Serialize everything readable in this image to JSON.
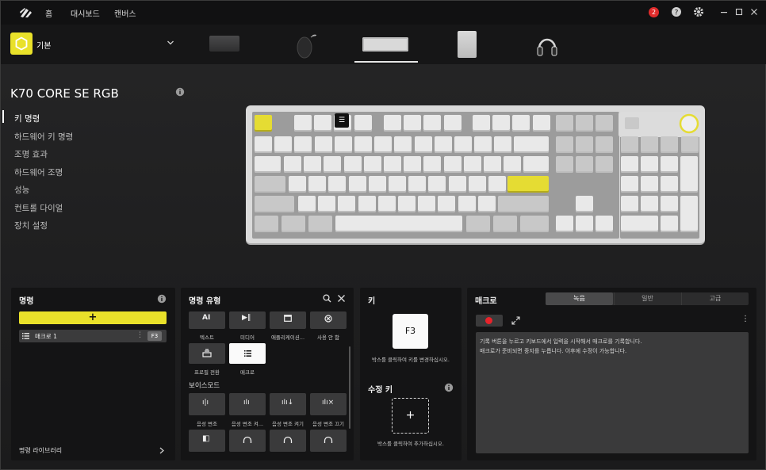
{
  "titlebar": {
    "nav": [
      "홈",
      "대시보드",
      "캔버스"
    ],
    "notif_count": "2"
  },
  "profile": {
    "name": "기본"
  },
  "device": {
    "name": "K70 CORE SE RGB"
  },
  "left_menu": [
    "키 명령",
    "하드웨어 키 명령",
    "조명 효과",
    "하드웨어 조명",
    "성능",
    "컨트롤 다이얼",
    "장치 설정"
  ],
  "commands_panel": {
    "title": "명령",
    "add": "+",
    "item_label": "매크로 1",
    "item_key": "F3",
    "library": "명령 라이브러리"
  },
  "command_types": {
    "title": "명령 유형",
    "row1": [
      "텍스트",
      "미디어",
      "애플리케이션...",
      "사용 안 함"
    ],
    "row2": [
      "프로필 전환",
      "매크로"
    ],
    "section": "보이스모드",
    "row3": [
      "음성 변조",
      "음성 변조 켜...",
      "음성 변조 켜기",
      "음성 변조 끄기"
    ]
  },
  "key_panel": {
    "title": "키",
    "key": "F3",
    "hint": "박스를 클릭하여 키를 변경하십시오.",
    "modifier_title": "수정 키",
    "modifier_add": "+",
    "modifier_hint": "박스를 클릭하여 추가하십시오."
  },
  "macro_panel": {
    "title": "매크로",
    "tabs": [
      "녹음",
      "일반",
      "고급"
    ],
    "text_line1": "기록 버튼을 누르고 키보드에서 입력을 시작해서 매크로를 기록합니다.",
    "text_line2": "매크로가 준비되면 중지를 누릅니다. 이후에 수정이 가능합니다."
  },
  "colors": {
    "accent": "#e9e12a",
    "record": "#e8232b",
    "badge": "#e02b2b"
  }
}
